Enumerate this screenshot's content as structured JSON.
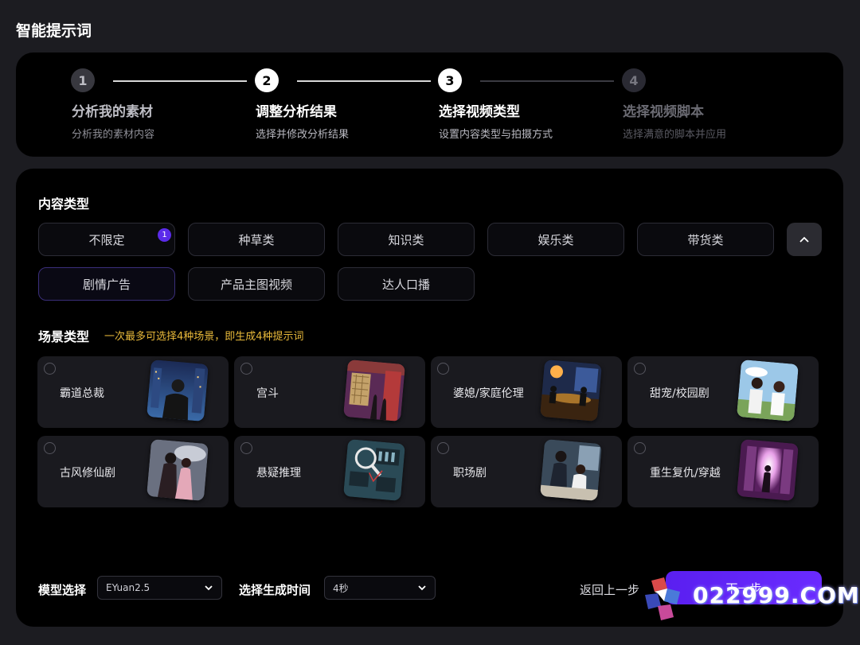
{
  "page_title": "智能提示词",
  "steps": [
    {
      "number": "1",
      "title": "分析我的素材",
      "subtitle": "分析我的素材内容"
    },
    {
      "number": "2",
      "title": "调整分析结果",
      "subtitle": "选择并修改分析结果"
    },
    {
      "number": "3",
      "title": "选择视频类型",
      "subtitle": "设置内容类型与拍摄方式"
    },
    {
      "number": "4",
      "title": "选择视频脚本",
      "subtitle": "选择满意的脚本并应用"
    }
  ],
  "content_type": {
    "label": "内容类型",
    "chips": [
      "不限定",
      "种草类",
      "知识类",
      "娱乐类",
      "带货类",
      "剧情广告",
      "产品主图视频",
      "达人口播"
    ],
    "badge_count": "1",
    "selected": "剧情广告"
  },
  "scene_type": {
    "label": "场景类型",
    "hint": "一次最多可选择4种场景，即生成4种提示词",
    "items": [
      "霸道总裁",
      "宫斗",
      "婆媳/家庭伦理",
      "甜宠/校园剧",
      "古风修仙剧",
      "悬疑推理",
      "职场剧",
      "重生复仇/穿越"
    ]
  },
  "footer": {
    "model_label": "模型选择",
    "model_value": "EYuan2.5",
    "time_label": "选择生成时间",
    "time_value": "4秒",
    "back_label": "返回上一步",
    "next_label": "下一步"
  },
  "watermark": "022999.COM",
  "colors": {
    "accent": "#5b2bea",
    "hint": "#e8b93a",
    "panel": "#000000",
    "background": "#1c1c21"
  }
}
